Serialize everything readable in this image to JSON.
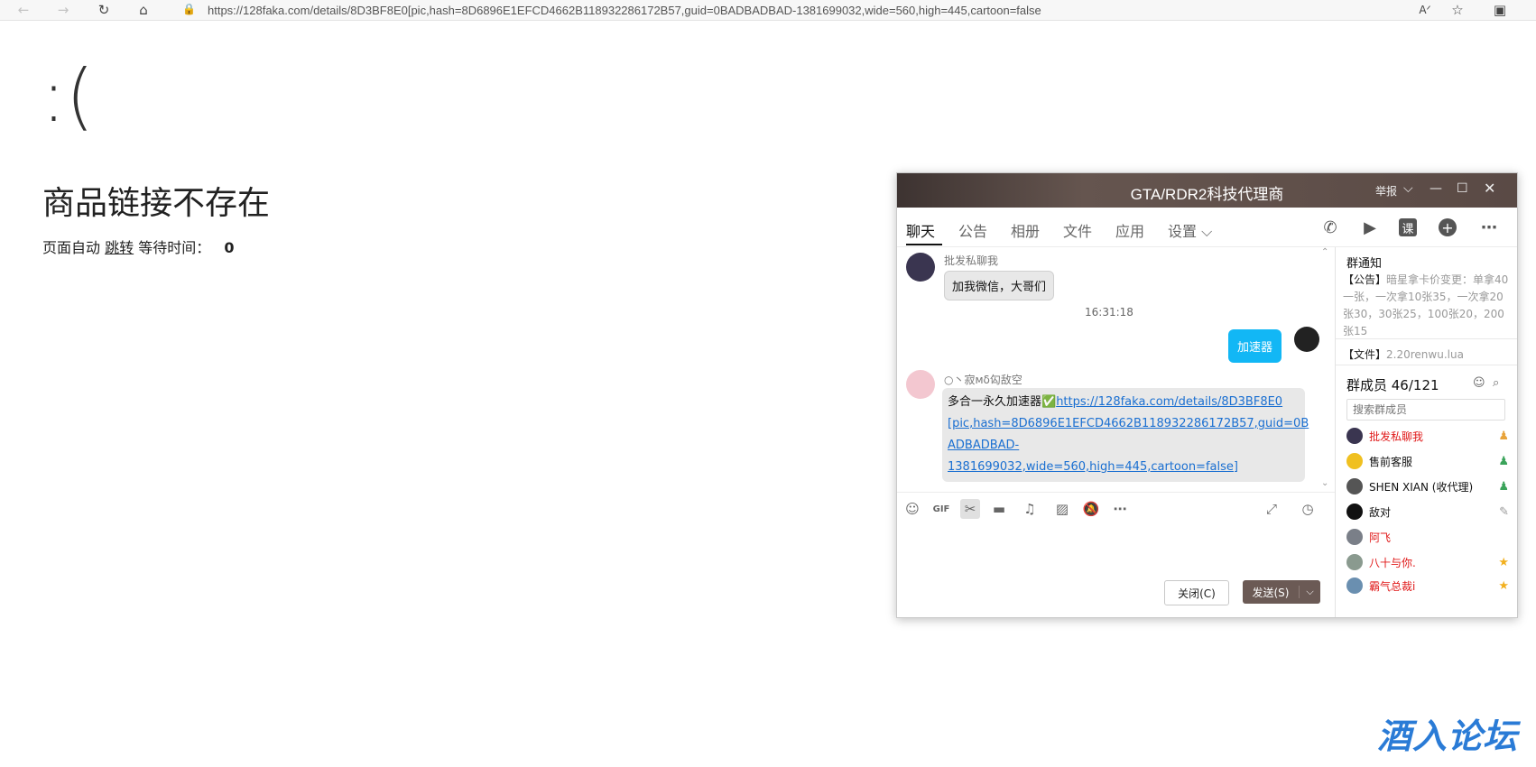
{
  "browser": {
    "url": "https://128faka.com/details/8D3BF8E0[pic,hash=8D6896E1EFCD4662B118932286172B57,guid=0BADBADBAD-1381699032,wide=560,high=445,cartoon=false"
  },
  "error_page": {
    "emoticon": ":(",
    "title": "商品链接不存在",
    "subtitle_prefix": "页面自动",
    "subtitle_link": "跳转",
    "subtitle_wait": "等待时间：",
    "countdown": "0"
  },
  "qq_window": {
    "title": "GTA/RDR2科技代理商",
    "report_label": "举报",
    "tabs": [
      {
        "label": "聊天"
      },
      {
        "label": "公告"
      },
      {
        "label": "相册"
      },
      {
        "label": "文件"
      },
      {
        "label": "应用"
      },
      {
        "label": "设置 ⌵"
      }
    ],
    "call_icon_text": "课",
    "messages": [
      {
        "sender": "批发私聊我",
        "text": "加我微信，大哥们"
      },
      {
        "time": "16:31:18"
      },
      {
        "text": "加速器"
      },
      {
        "sender": "○丶寂мδ匃敌空",
        "text_prefix": "多合一永久加速器✅",
        "link_line1": "https://128faka.com/details/8D3BF8E0",
        "link_line2": "[pic,hash=8D6896E1EFCD4662B118932286172B57,guid=0B",
        "link_line3": "ADBADBAD-1381699032,wide=560,high=445,cartoon=false]"
      }
    ],
    "close_button": "关闭(C)",
    "send_button": "发送(S)",
    "right_panel": {
      "notice_header": "群通知",
      "notice_tag": "【公告】",
      "notice_text": "暗星拿卡价变更：单拿40一张，一次拿10张35，一次拿20张30，30张25，100张20，200张15",
      "file_tag": "【文件】",
      "file_name": "2.20renwu.lua",
      "members_header": "群成员 46/121",
      "search_placeholder": "搜索群成员",
      "members": [
        {
          "name": "批发私聊我"
        },
        {
          "name": "售前客服"
        },
        {
          "name": "SHEN XIAN (收代理)"
        },
        {
          "name": "敌对"
        },
        {
          "name": "阿飞"
        },
        {
          "name": "八十与你."
        },
        {
          "name": "霸气总裁i"
        }
      ]
    }
  },
  "watermark": "酒入论坛"
}
